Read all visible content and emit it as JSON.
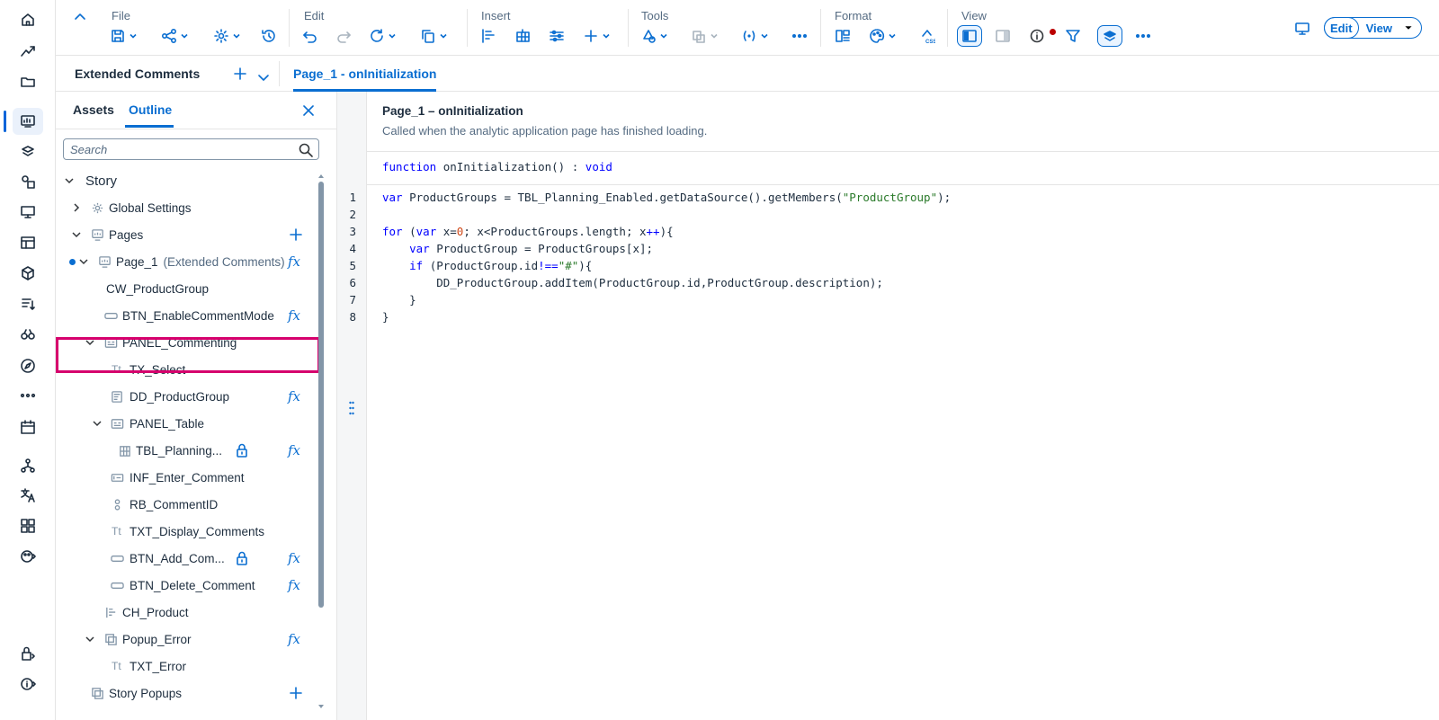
{
  "toolbar": {
    "groups": {
      "file": "File",
      "edit": "Edit",
      "insert": "Insert",
      "tools": "Tools",
      "format": "Format",
      "view": "View"
    },
    "mode": {
      "edit": "Edit",
      "view": "View"
    }
  },
  "tabs": {
    "story_name": "Extended Comments",
    "script_tab": "Page_1 - onInitialization"
  },
  "panel": {
    "tabs": {
      "assets": "Assets",
      "outline": "Outline"
    },
    "search_placeholder": "Search",
    "tree": [
      {
        "label": "Story",
        "icon": "none",
        "expanded": true
      },
      {
        "label": "Global Settings",
        "icon": "gear-icon",
        "expanded": false
      },
      {
        "label": "Pages",
        "icon": "page-icon",
        "expanded": true
      },
      {
        "label": "Page_1",
        "sub": "(Extended Comments)",
        "icon": "page-icon",
        "expanded": true,
        "selected": true
      },
      {
        "label": "CW_ProductGroup",
        "icon": "none"
      },
      {
        "label": "BTN_EnableCommentMode",
        "icon": "button-icon"
      },
      {
        "label": "PANEL_Commenting",
        "icon": "panel-icon",
        "expanded": true
      },
      {
        "label": "TX_Select",
        "icon": "text-icon",
        "icon_text": "Tt"
      },
      {
        "label": "DD_ProductGroup",
        "icon": "dropdown-icon"
      },
      {
        "label": "PANEL_Table",
        "icon": "panel-icon",
        "expanded": true
      },
      {
        "label": "TBL_Planning...",
        "icon": "table-icon"
      },
      {
        "label": "INF_Enter_Comment",
        "icon": "input-field-icon"
      },
      {
        "label": "RB_CommentID",
        "icon": "radio-button-icon"
      },
      {
        "label": "TXT_Display_Comments",
        "icon": "text-icon",
        "icon_text": "Tt"
      },
      {
        "label": "BTN_Add_Com...",
        "icon": "button-icon"
      },
      {
        "label": "BTN_Delete_Comment",
        "icon": "button-icon"
      },
      {
        "label": "CH_Product",
        "icon": "chart-icon"
      },
      {
        "label": "Popup_Error",
        "icon": "popup-icon",
        "expanded": true
      },
      {
        "label": "TXT_Error",
        "icon": "text-icon",
        "icon_text": "Tt"
      },
      {
        "label": "Story Popups",
        "icon": "popup-icon"
      }
    ],
    "fx_symbol": "fx"
  },
  "editor": {
    "title": "Page_1 – onInitialization",
    "description": "Called when the analytic application page has finished loading.",
    "signature": {
      "keyword": "function",
      "name": "onInitialization() : ",
      "return_type": "void"
    },
    "line_numbers": [
      "1",
      "2",
      "3",
      "4",
      "5",
      "6",
      "7",
      "8"
    ],
    "code": {
      "l1_kw": "var",
      "l1_a": " ProductGroups = TBL_Planning_Enabled.getDataSource().getMembers(",
      "l1_str": "\"ProductGroup\"",
      "l1_b": ");",
      "l3_kw1": "for",
      "l3_a": " (",
      "l3_kw2": "var",
      "l3_b": " x=",
      "l3_num": "0",
      "l3_c": "; x<ProductGroups.length; x",
      "l3_op": "++",
      "l3_d": "){",
      "l4_indent": "    ",
      "l4_kw": "var",
      "l4_a": " ProductGroup = ProductGroups[x];",
      "l5_indent": "    ",
      "l5_kw": "if",
      "l5_a": " (ProductGroup.id",
      "l5_op": "!==",
      "l5_str": "\"#\"",
      "l5_b": "){",
      "l6": "        DD_ProductGroup.addItem(ProductGroup.id,ProductGroup.description);",
      "l7": "    }",
      "l8": "}"
    }
  },
  "colors": {
    "accent": "#0a6ed1",
    "highlight_border": "#d6006d",
    "keyword": "#0000ff",
    "string": "#2a7a2a",
    "number": "#d04a1a",
    "notification_dot": "#bb0000"
  }
}
